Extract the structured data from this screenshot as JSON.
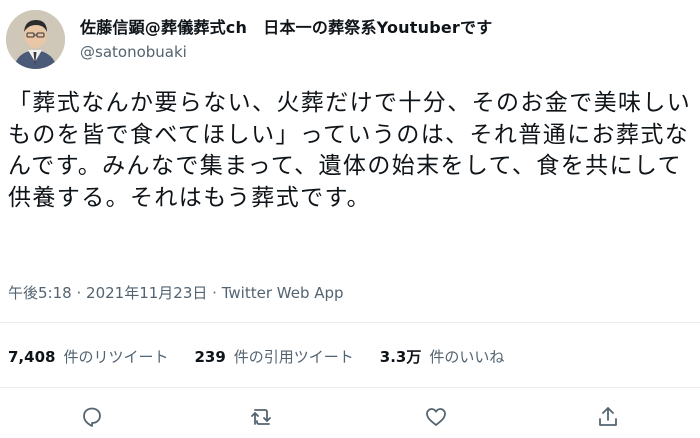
{
  "tweet": {
    "display_name": "佐藤信顕@葬儀葬式ch　日本一の葬祭系Youtuberです",
    "username": "@satonobuaki",
    "text": "「葬式なんか要らない、火葬だけで十分、そのお金で美味しいものを皆で食べてほしい」っていうのは、それ普通にお葬式なんです。みんなで集まって、遺体の始末をして、食を共にして供養する。それはもう葬式です。",
    "time": "午後5:18",
    "separator": "·",
    "date": "2021年11月23日",
    "source": "Twitter Web App"
  },
  "stats": {
    "retweets": "7,408",
    "retweets_label": "件のリツイート",
    "quotes": "239",
    "quotes_label": "件の引用ツイート",
    "likes": "3.3万",
    "likes_label": "件のいいね"
  },
  "actions": {
    "reply_icon": "reply-icon",
    "retweet_icon": "retweet-icon",
    "like_icon": "heart-icon",
    "share_icon": "share-icon"
  }
}
